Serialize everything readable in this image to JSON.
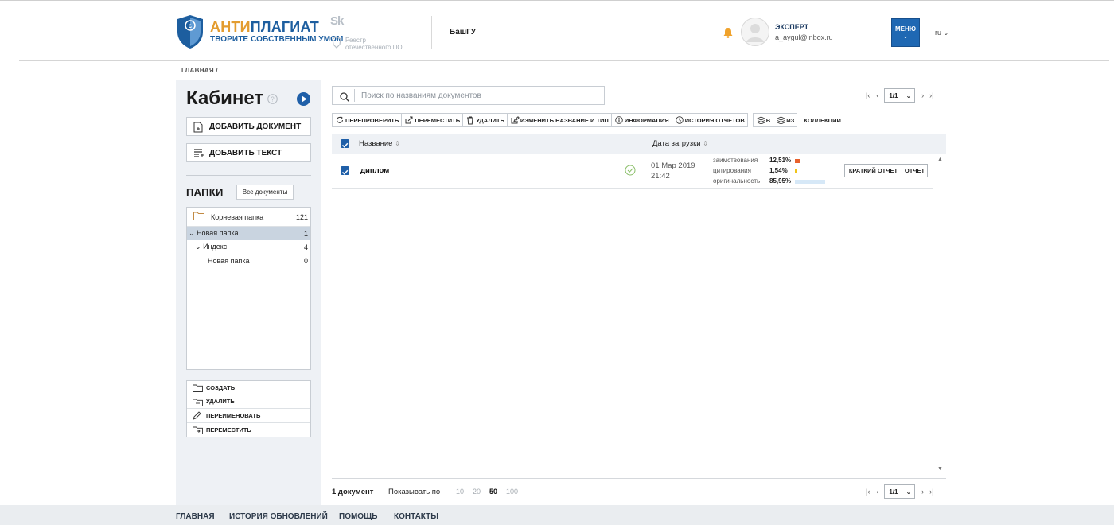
{
  "header": {
    "logo_main_a": "АНТИ",
    "logo_main_b": "ПЛАГИАТ",
    "logo_sub": "ТВОРИТЕ СОБСТВЕННЫМ УМОМ",
    "sk": "Sk",
    "registry_line1": "Реестр",
    "registry_line2": "отечественного ПО",
    "org": "БашГУ",
    "user_role": "ЭКСПЕРТ",
    "user_email": "a_aygul@inbox.ru",
    "menu_label": "МЕНЮ",
    "lang": "ru"
  },
  "breadcrumb": "ГЛАВНАЯ /",
  "sidebar": {
    "title": "Кабинет",
    "add_document": "ДОБАВИТЬ ДОКУМЕНТ",
    "add_text": "ДОБАВИТЬ ТЕКСТ",
    "folders_title": "ПАПКИ",
    "all_docs": "Все документы",
    "tree": [
      {
        "label": "Корневая папка",
        "count": "121"
      },
      {
        "label": "Новая папка",
        "count": "1"
      },
      {
        "label": "Индекс",
        "count": "4"
      },
      {
        "label": "Новая папка",
        "count": "0"
      }
    ],
    "actions": [
      "СОЗДАТЬ",
      "УДАЛИТЬ",
      "ПЕРЕИМЕНОВАТЬ",
      "ПЕРЕМЕСТИТЬ"
    ]
  },
  "main": {
    "search_placeholder": "Поиск по названиям документов",
    "page_indicator": "1/1",
    "toolbar": [
      "ПЕРЕПРОВЕРИТЬ",
      "ПЕРЕМЕСТИТЬ",
      "УДАЛИТЬ",
      "ИЗМЕНИТЬ НАЗВАНИЕ И ТИП",
      "ИНФОРМАЦИЯ",
      "ИСТОРИЯ ОТЧЕТОВ"
    ],
    "coll_in": "В",
    "coll_from": "ИЗ",
    "collections": "КОЛЛЕКЦИИ",
    "col_name": "Название",
    "col_date": "Дата загрузки",
    "rows": [
      {
        "name": "диплом",
        "date": "01 Мар 2019",
        "time": "21:42",
        "metrics": [
          {
            "label": "заимствования",
            "value": "12,51%",
            "fraction": 0.1251,
            "color": "#e8612c"
          },
          {
            "label": "цитирования",
            "value": "1,54%",
            "fraction": 0.0154,
            "color": "#f0c419"
          },
          {
            "label": "оригинальность",
            "value": "85,95%",
            "fraction": 0.8595,
            "color": "#d6e8f7"
          }
        ],
        "short_report": "КРАТКИЙ ОТЧЕТ",
        "report": "ОТЧЕТ"
      }
    ],
    "footer_count": "1 документ",
    "show_by": "Показывать по",
    "per_page": [
      "10",
      "20",
      "50",
      "100"
    ]
  },
  "footer_links": [
    "ГЛАВНАЯ",
    "ИСТОРИЯ ОБНОВЛЕНИЙ",
    "ПОМОЩЬ",
    "КОНТАКТЫ"
  ]
}
